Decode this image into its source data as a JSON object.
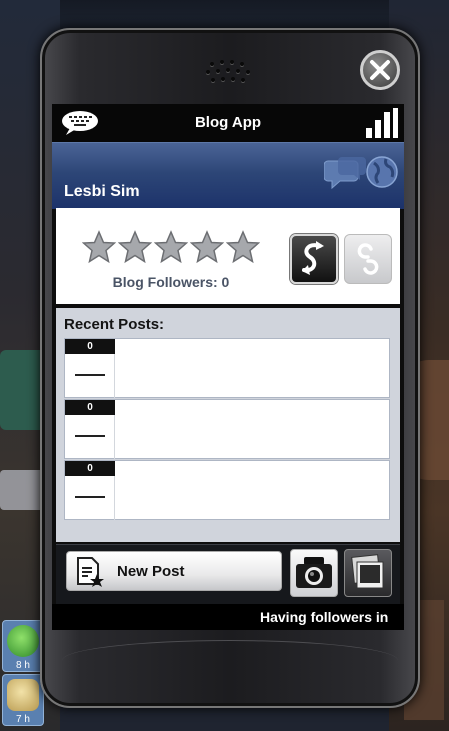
{
  "app": {
    "title": "Blog App",
    "user_name": "Lesbi Sim"
  },
  "rating": {
    "stars_filled": 0,
    "stars_total": 5,
    "followers_label": "Blog Followers: 0"
  },
  "posts": {
    "heading": "Recent Posts:",
    "items": [
      {
        "count": "0",
        "thumb": "—"
      },
      {
        "count": "0",
        "thumb": "—"
      },
      {
        "count": "0",
        "thumb": "—"
      }
    ]
  },
  "actions": {
    "new_post_label": "New Post"
  },
  "ticker": {
    "text": "Having followers in"
  },
  "hud": {
    "badges": [
      {
        "time": "8 h",
        "icon": "smiley-face-icon"
      },
      {
        "time": "7 h",
        "icon": "food-icon"
      }
    ]
  },
  "colors": {
    "profile_bar": "#2d4677",
    "screen_bg": "#0d0d0d",
    "posts_bg": "#d0d4dc"
  }
}
